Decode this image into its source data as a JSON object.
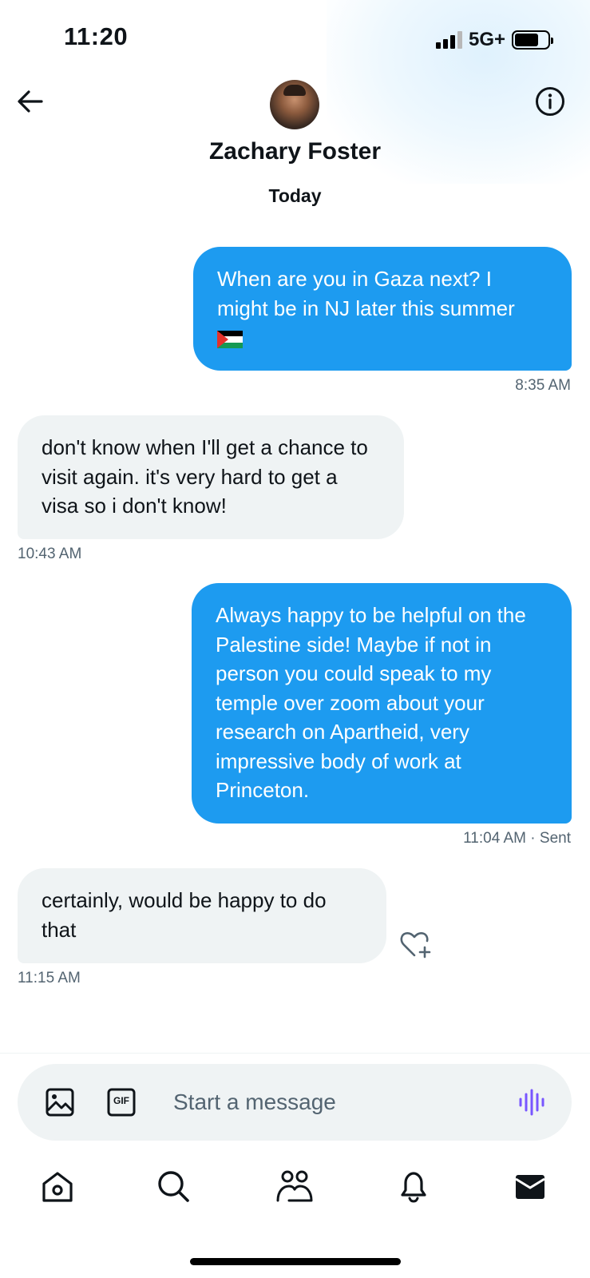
{
  "status_bar": {
    "time": "11:20",
    "network": "5G+"
  },
  "header": {
    "contact_name": "Zachary Foster"
  },
  "conversation": {
    "day_label": "Today",
    "messages": [
      {
        "direction": "out",
        "text": "When are you in Gaza next? I might be in NJ later this summer",
        "emoji": "palestine-flag",
        "time": "8:35 AM"
      },
      {
        "direction": "in",
        "text": "don't know when I'll get a chance to visit again. it's very hard to get a visa so i don't know!",
        "time": "10:43 AM"
      },
      {
        "direction": "out",
        "text": "Always happy to be helpful on the Palestine side! Maybe if not in person you could speak to my temple over zoom about your research on Apartheid, very impressive body of work at Princeton.",
        "time": "11:04 AM",
        "status": "· Sent"
      },
      {
        "direction": "in",
        "text": "certainly, would be happy to do that",
        "time": "11:15 AM"
      }
    ]
  },
  "composer": {
    "placeholder": "Start a message",
    "gif_label": "GIF"
  },
  "tabs": [
    "home-icon",
    "search-icon",
    "communities-icon",
    "notifications-icon",
    "messages-icon"
  ],
  "colors": {
    "accent": "#1d9bf0",
    "incoming_bubble": "#eff3f4",
    "voice_icon": "#7856ff"
  }
}
